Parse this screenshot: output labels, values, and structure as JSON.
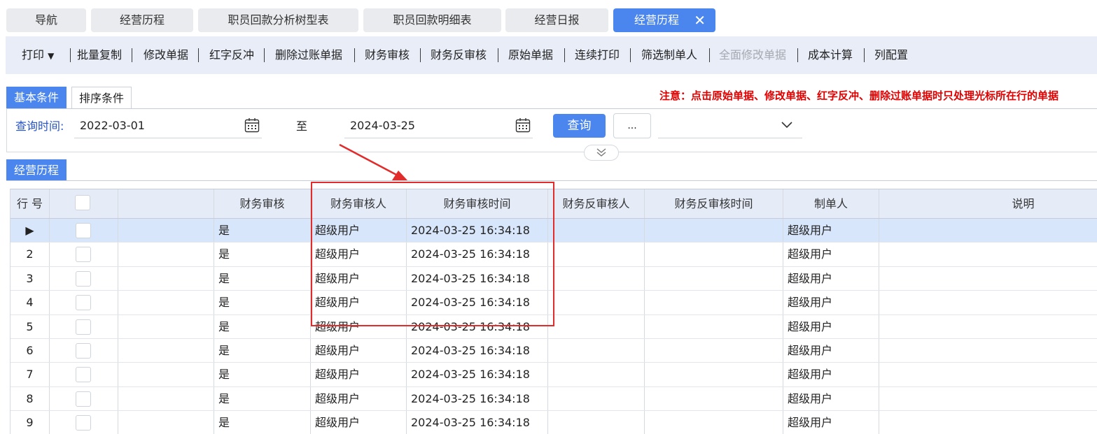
{
  "tabs": [
    {
      "label": "导航"
    },
    {
      "label": "经营历程"
    },
    {
      "label": "职员回款分析树型表"
    },
    {
      "label": "职员回款明细表"
    },
    {
      "label": "经营日报"
    },
    {
      "label": "经营历程",
      "active": true
    }
  ],
  "toolbar": {
    "items": [
      "打印",
      "批量复制",
      "修改单据",
      "红字反冲",
      "删除过账单据",
      "财务审核",
      "财务反审核",
      "原始单据",
      "连续打印",
      "筛选制单人",
      "全面修改单据",
      "成本计算",
      "列配置"
    ],
    "disabled": [
      "全面修改单据"
    ],
    "print_arrow": "▼"
  },
  "conditions": {
    "tab_basic": "基本条件",
    "tab_sort": "排序条件",
    "notice": "注意：点击原始单据、修改单据、红字反冲、删除过账单据时只处理光标所在行的单据"
  },
  "query": {
    "label": "查询时间:",
    "from": "2022-03-01",
    "to_label": "至",
    "to": "2024-03-25",
    "query_button": "查询",
    "more_button": "...",
    "select_value": ""
  },
  "grid": {
    "title": "经营历程",
    "columns": [
      "行 号",
      "",
      "",
      "财务审核",
      "财务审核人",
      "财务审核时间",
      "财务反审核人",
      "财务反审核时间",
      "制单人",
      "说明"
    ],
    "rows": [
      {
        "no": "▶",
        "audit": "是",
        "auditor": "超级用户",
        "audit_time": "2024-03-25 16:34:18",
        "maker": "超级用户"
      },
      {
        "no": "2",
        "audit": "是",
        "auditor": "超级用户",
        "audit_time": "2024-03-25 16:34:18",
        "maker": "超级用户"
      },
      {
        "no": "3",
        "audit": "是",
        "auditor": "超级用户",
        "audit_time": "2024-03-25 16:34:18",
        "maker": "超级用户"
      },
      {
        "no": "4",
        "audit": "是",
        "auditor": "超级用户",
        "audit_time": "2024-03-25 16:34:18",
        "maker": "超级用户"
      },
      {
        "no": "5",
        "audit": "是",
        "auditor": "超级用户",
        "audit_time": "2024-03-25 16:34:18",
        "maker": "超级用户"
      },
      {
        "no": "6",
        "audit": "是",
        "auditor": "超级用户",
        "audit_time": "2024-03-25 16:34:18",
        "maker": "超级用户"
      },
      {
        "no": "7",
        "audit": "是",
        "auditor": "超级用户",
        "audit_time": "2024-03-25 16:34:18",
        "maker": "超级用户"
      },
      {
        "no": "8",
        "audit": "是",
        "auditor": "超级用户",
        "audit_time": "2024-03-25 16:34:18",
        "maker": "超级用户"
      },
      {
        "no": "9",
        "audit": "是",
        "auditor": "超级用户",
        "audit_time": "2024-03-25 16:34:18",
        "maker": "超级用户"
      }
    ]
  },
  "colors": {
    "accent": "#4a86ee",
    "notice": "#e00000",
    "highlight": "#e22b2b"
  },
  "icons": [
    "calendar-icon",
    "chevron-down-icon",
    "double-chevron-down-icon",
    "close-icon",
    "current-row-arrow-icon"
  ]
}
